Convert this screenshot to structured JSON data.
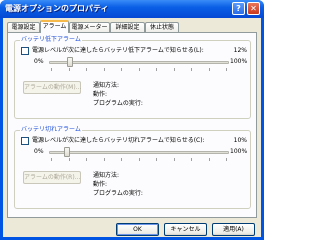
{
  "window": {
    "title": "電源オプションのプロパティ",
    "help_label": "?",
    "close_label": "✕"
  },
  "tabs": [
    {
      "label": "電源設定",
      "active": false
    },
    {
      "label": "アラーム",
      "active": true
    },
    {
      "label": "電源メーター",
      "active": false
    },
    {
      "label": "詳細設定",
      "active": false
    },
    {
      "label": "休止状態",
      "active": false
    }
  ],
  "low_alarm": {
    "group_title": "バッテリ低下アラーム",
    "checkbox_label": "電源レベルが次に達したらバッテリ低下アラームで知らせる(L):",
    "checked": false,
    "value_text": "12%",
    "level": 12,
    "min_label": "0%",
    "max_label": "100%",
    "action_button": "アラームの動作(M)...",
    "info": [
      "通知方法:",
      "動作:",
      "プログラムの実行:"
    ]
  },
  "critical_alarm": {
    "group_title": "バッテリ切れアラーム",
    "checkbox_label": "電源レベルが次に達したらバッテリ切れアラームで知らせる(C):",
    "checked": false,
    "value_text": "10%",
    "level": 10,
    "min_label": "0%",
    "max_label": "100%",
    "action_button": "アラームの動作(R)...",
    "info": [
      "通知方法:",
      "動作:",
      "プログラムの実行:"
    ]
  },
  "buttons": {
    "ok": "OK",
    "cancel": "キャンセル",
    "apply": "適用(A)"
  }
}
